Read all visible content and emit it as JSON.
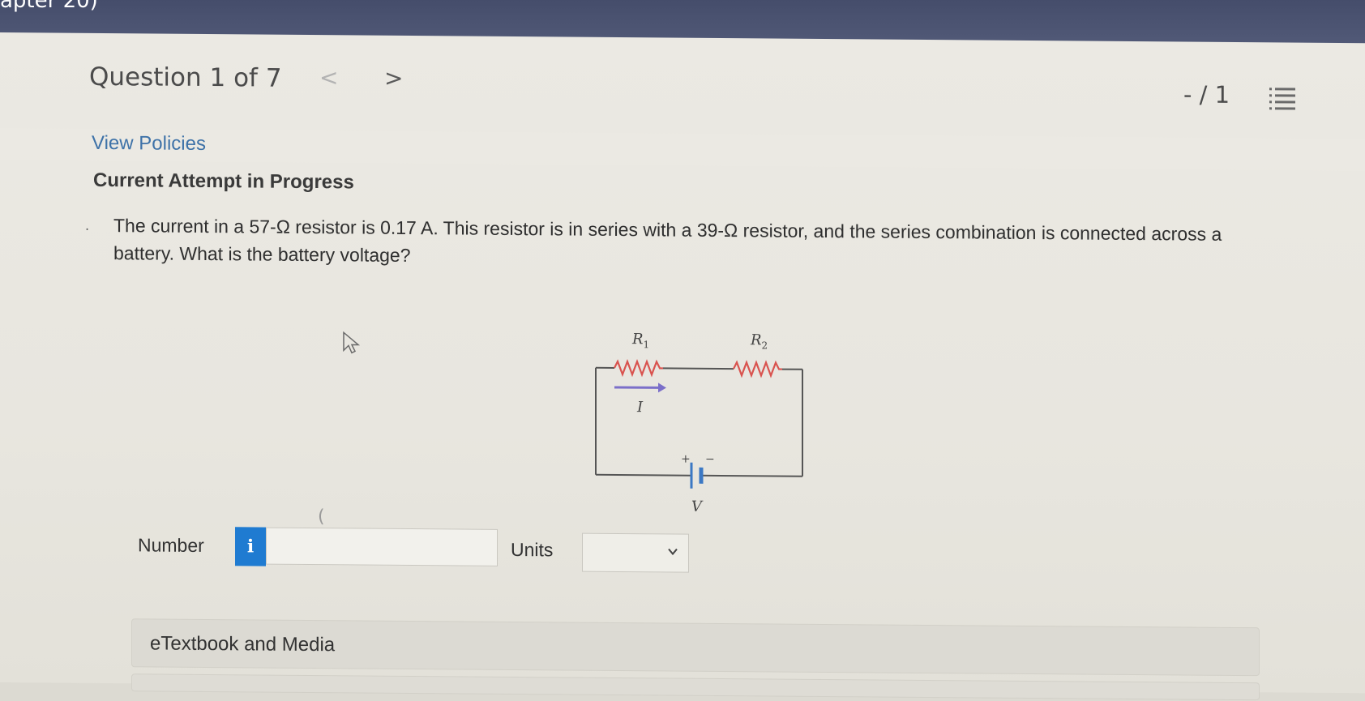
{
  "top_bar": {
    "partial_text": "apter 20)"
  },
  "header": {
    "question_label": "Question 1 of 7",
    "prev_glyph": "<",
    "next_glyph": ">",
    "score": "- / 1",
    "list_icon": "list-icon"
  },
  "links": {
    "view_policies": "View Policies"
  },
  "attempt": {
    "status": "Current Attempt in Progress"
  },
  "question": {
    "text": "The current in a 57-Ω resistor is 0.17 A. This resistor is in series with a 39-Ω resistor, and the series combination is connected across a battery. What is the battery voltage?"
  },
  "circuit": {
    "r1_label": "R",
    "r1_sub": "1",
    "r2_label": "R",
    "r2_sub": "2",
    "current_label": "I",
    "voltage_label": "V",
    "plus_sign": "+",
    "minus_sign": "−",
    "resistor_color": "#d9534f",
    "arrow_color": "#7b6fc9",
    "battery_color": "#3b78c4"
  },
  "answer": {
    "number_label": "Number",
    "info_glyph": "i",
    "number_value": "",
    "units_label": "Units",
    "units_selected": ""
  },
  "etextbook": {
    "label": "eTextbook and Media"
  },
  "colors": {
    "link": "#3e72a8",
    "info_badge": "#1f7bd1",
    "top_bar": "#4a526f"
  }
}
